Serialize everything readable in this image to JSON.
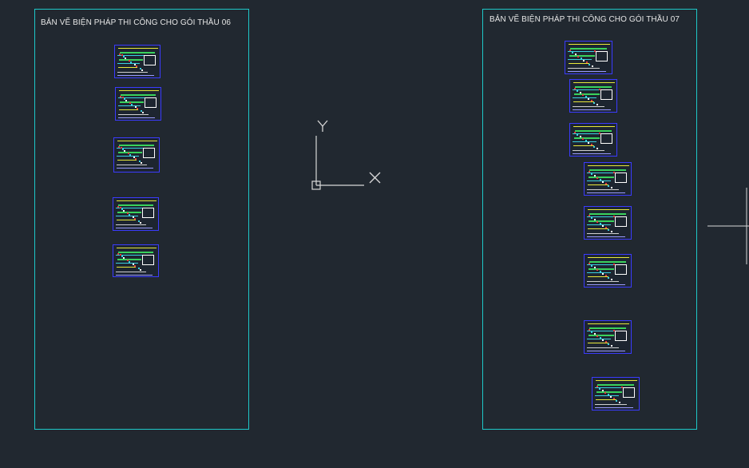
{
  "app": "CAD model space viewer",
  "colors": {
    "background": "#212830",
    "frame": "#1ec8c8",
    "sheet_border": "#3b3bff",
    "accent_yellow": "#e8e83a",
    "accent_green": "#39d25c",
    "accent_cyan": "#3ad0e0",
    "accent_red": "#e23b3b",
    "ucs": "#d8d8d8"
  },
  "frames": [
    {
      "id": "frame-06",
      "title": "BẢN VẼ BIỆN PHÁP THI CÔNG CHO GÓI THẦU 06",
      "sheet_count": 5
    },
    {
      "id": "frame-07",
      "title": "BẢN VẼ BIỆN PHÁP THI CÔNG CHO GÓI THẦU 07",
      "sheet_count": 8
    }
  ],
  "ucs_icon": {
    "x_label": "X",
    "y_label": "Y",
    "icon": "ucs-icon"
  },
  "crosshair": {
    "icon": "crosshair-cursor-icon"
  }
}
